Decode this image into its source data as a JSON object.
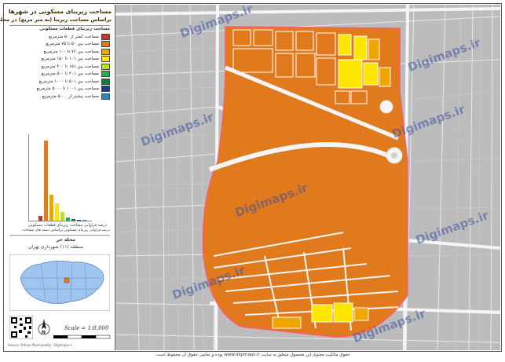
{
  "sidebar": {
    "title_line1": "مساحت زیربنای مسکونی در شهرها",
    "title_line2": "براساس مساحت زیربنا (به متر مربع) در محله حر",
    "legend_header": "مساحت زیربنای قطعات مسکونی",
    "legend": [
      {
        "label": "مساحت کمتر از ۵۰ مترمربع",
        "color": "#c0392b"
      },
      {
        "label": "مساحت بین ۵۰ تا ۷۵ مترمربع",
        "color": "#e07a1c"
      },
      {
        "label": "مساحت بین ۷۶ تا ۱۰۰ مترمربع",
        "color": "#f0a500"
      },
      {
        "label": "مساحت بین ۱۰۱ تا ۱۵۰ مترمربع",
        "color": "#ffe600"
      },
      {
        "label": "مساحت بین ۱۵۱ تا ۲۰۰ مترمربع",
        "color": "#b5e61d"
      },
      {
        "label": "مساحت بین ۲۰۱ تا ۵۰۰ مترمربع",
        "color": "#22b14c"
      },
      {
        "label": "مساحت بین ۵۰۱ تا ۱۰۰۰ مترمربع",
        "color": "#117a3a"
      },
      {
        "label": "مساحت بین ۱۰۰۱ تا ۵۰۰۰ مترمربع",
        "color": "#1f3a93"
      },
      {
        "label": "مساحت بیشتر از ۵۰۰۰ مترمربع",
        "color": "#2e86c1"
      }
    ],
    "histogram": [
      {
        "value": 6,
        "color": "#c0392b"
      },
      {
        "value": 100,
        "color": "#e07a1c"
      },
      {
        "value": 32,
        "color": "#f0a500"
      },
      {
        "value": 22,
        "color": "#ffe600"
      },
      {
        "value": 11,
        "color": "#b5e61d"
      },
      {
        "value": 4,
        "color": "#22b14c"
      },
      {
        "value": 2,
        "color": "#117a3a"
      },
      {
        "value": 1,
        "color": "#1f3a93"
      },
      {
        "value": 1,
        "color": "#2e86c1"
      }
    ],
    "chart_caption1": "درصد فراوانی مساحت زیربنای قطعات مسکونی",
    "chart_caption2": "درصد فراوانی زیربنای مسکونی براساس دسته های مساحت",
    "place_name": "محله حر",
    "district": "منطقه (۱۱) شهرداری تهران",
    "scale": "Scale = 1:8,000",
    "north_label": "N",
    "credits": "Source: Tehran Municipality · Digimaps.ir"
  },
  "map": {
    "watermarks": [
      "Digimaps.ir",
      "Digimaps.ir",
      "Digimaps.ir",
      "Digimaps.ir",
      "Digimaps.ir",
      "Digimaps.ir",
      "Digimaps.ir",
      "Digimaps.ir"
    ],
    "colors": {
      "background": "#bcbcbc",
      "roads": "#f2f2f2",
      "block_main": "#e07a1c",
      "block_yellow": "#ffe600",
      "block_amber": "#f0a500",
      "boundary": "#ff5a6e"
    }
  },
  "footer": {
    "text": "حقوق مالکیت معنوی این محصول متعلق به سایت www.digimaps.ir بوده و تمامی حقوق آن محفوظ است."
  }
}
